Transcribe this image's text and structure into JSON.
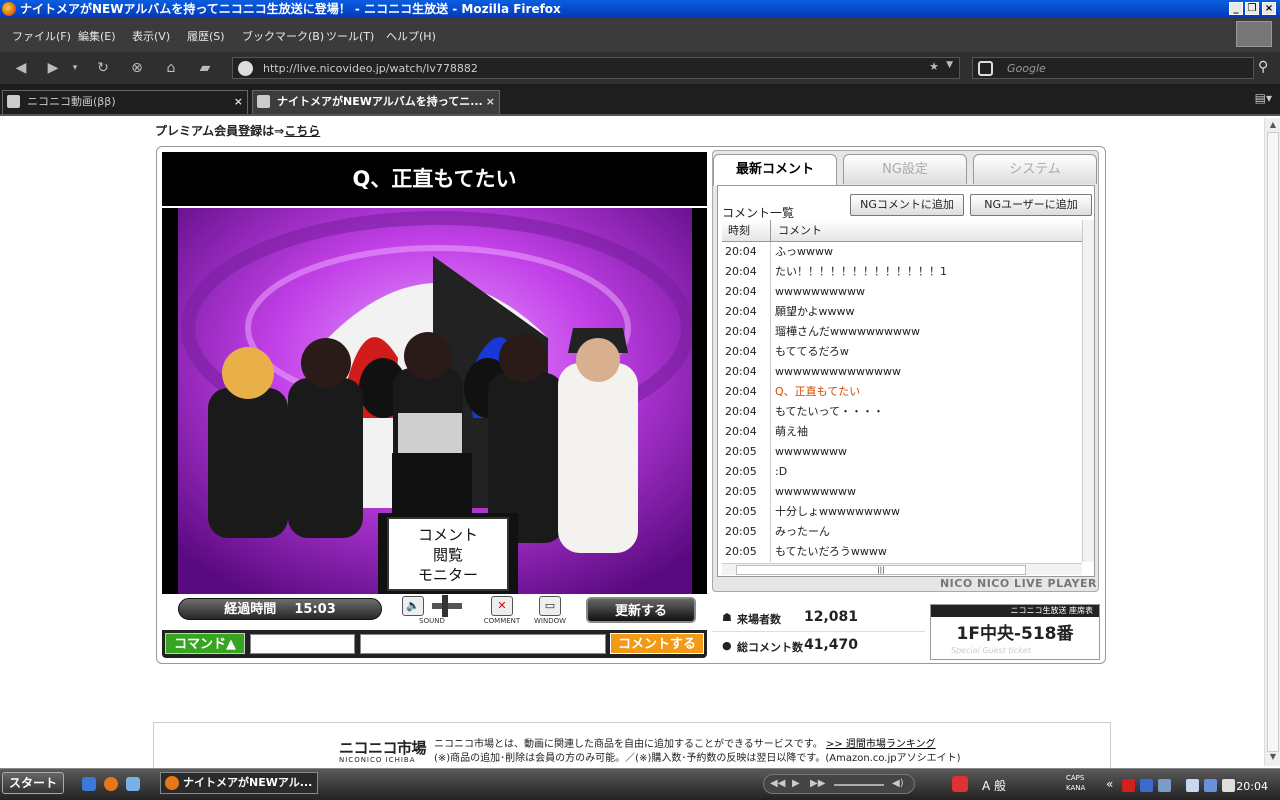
{
  "window": {
    "title": "ナイトメアがNEWアルバムを持ってニコニコ生放送に登場！ - ニコニコ生放送 - Mozilla Firefox",
    "controls": [
      "_",
      "❐",
      "×"
    ]
  },
  "menu": [
    "ファイル(F)",
    "編集(E)",
    "表示(V)",
    "履歴(S)",
    "ブックマーク(B)",
    "ツール(T)",
    "ヘルプ(H)"
  ],
  "nav": {
    "url": "http://live.nicovideo.jp/watch/lv778882",
    "search_placeholder": "Google"
  },
  "tabs": [
    {
      "label": "ニコニコ動画(ββ)",
      "active": false
    },
    {
      "label": "ナイトメアがNEWアルバムを持ってニ...",
      "active": true
    }
  ],
  "page": {
    "premium_text": "プレミアム会員登録は⇒",
    "premium_link": "こちら"
  },
  "player": {
    "video_title": "Q、正直もてたい",
    "monitor_sign": [
      "コメント",
      "閲覧",
      "モニター"
    ],
    "elapsed_label": "経過時間",
    "elapsed_value": "15:03",
    "sound_label": "SOUND",
    "comment_label": "COMMENT",
    "window_label": "WINDOW",
    "refresh_label": "更新する",
    "command_label": "コマンド▲",
    "comment_send_label": "コメントする"
  },
  "panel": {
    "tabs": [
      "最新コメント",
      "NG設定",
      "システム"
    ],
    "list_title": "コメント一覧",
    "ng_comment_btn": "NGコメントに追加",
    "ng_user_btn": "NGユーザーに追加",
    "col_time": "時刻",
    "col_comment": "コメント",
    "comments": [
      {
        "time": "20:04",
        "text": "ふっwwww",
        "hl": false
      },
      {
        "time": "20:04",
        "text": "たい！！！！！！！！！！！！！1",
        "hl": false
      },
      {
        "time": "20:04",
        "text": "wwwwwwwwww",
        "hl": false
      },
      {
        "time": "20:04",
        "text": "願望かよwwww",
        "hl": false
      },
      {
        "time": "20:04",
        "text": "瑠樺さんだwwwwwwwwww",
        "hl": false
      },
      {
        "time": "20:04",
        "text": "もててるだろw",
        "hl": false
      },
      {
        "time": "20:04",
        "text": "wwwwwwwwwwwwww",
        "hl": false
      },
      {
        "time": "20:04",
        "text": "Q、正直もてたい",
        "hl": true
      },
      {
        "time": "20:04",
        "text": "もてたいって・・・・",
        "hl": false
      },
      {
        "time": "20:04",
        "text": "萌え袖",
        "hl": false
      },
      {
        "time": "20:05",
        "text": "wwwwwwww",
        "hl": false
      },
      {
        "time": "20:05",
        "text": ":D",
        "hl": false
      },
      {
        "time": "20:05",
        "text": "wwwwwwwww",
        "hl": false
      },
      {
        "time": "20:05",
        "text": "十分しょwwwwwwwww",
        "hl": false
      },
      {
        "time": "20:05",
        "text": "みったーん",
        "hl": false
      },
      {
        "time": "20:05",
        "text": "もてたいだろうwwww",
        "hl": false
      }
    ],
    "brand": "NICO NICO LIVE PLAYER"
  },
  "stats": {
    "visitors_label": "来場者数",
    "visitors_value": "12,081",
    "comments_label": "総コメント数",
    "comments_value": "41,470"
  },
  "seat": {
    "header": "ニコニコ生放送 座席表",
    "value": "1F中央-518番",
    "footer": "Special Guest ticket"
  },
  "ichiba": {
    "logo": "ニコニコ市場",
    "logo_sub": "NICONICO ICHIBA",
    "line1": "ニコニコ市場とは、動画に関連した商品を自由に追加することができるサービスです。",
    "line1_link": ">> 週間市場ランキング",
    "line2": "(※)商品の追加･削除は会員の方のみ可能。／(※)購入数･予約数の反映は翌日以降です。(Amazon.co.jpアソシエイト)"
  },
  "taskbar": {
    "start_label": "スタート",
    "task_item": "ナイトメアがNEWアル...",
    "ime_text": "A 般",
    "caps": "CAPS",
    "kana": "KANA",
    "clock": "20:04"
  },
  "colors": {
    "title_blue": "#0338b8",
    "highlight_comment": "#d24a00",
    "command_green": "#37a51f",
    "send_orange": "#f29a16"
  }
}
